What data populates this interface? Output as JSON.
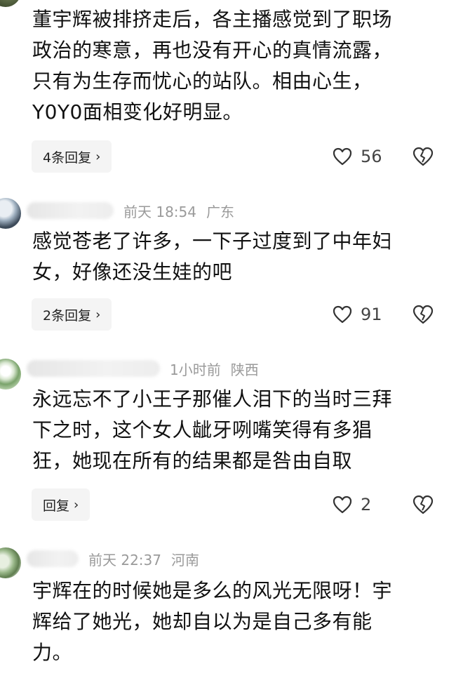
{
  "comments": [
    {
      "name": "",
      "time": "",
      "location": "",
      "text": "董宇辉被排挤走后，各主播感觉到了职场\n政治的寒意，再也没有开心的真情流露，\n只有为生存而忧心的站队。相由心生，\nY0Y0面相变化好明显。",
      "reply_label": "4条回复",
      "like_count": "56"
    },
    {
      "name": "",
      "time": "前天 18:54",
      "location": "广东",
      "text": "感觉苍老了许多，一下子过度到了中年妇\n女，好像还没生娃的吧",
      "reply_label": "2条回复",
      "like_count": "91"
    },
    {
      "name": "",
      "time": "1小时前",
      "location": "陕西",
      "text": "永远忘不了小王子那催人泪下的当时三拜\n下之时，这个女人龇牙咧嘴笑得有多猖\n狂，她现在所有的结果都是咎由自取",
      "reply_label": "回复",
      "like_count": "2"
    },
    {
      "name": "",
      "time": "前天 22:37",
      "location": "河南",
      "text": "宇辉在的时候她是多么的风光无限呀！宇\n辉给了她光，她却自以为是自己多有能\n力。"
    }
  ],
  "icons": {
    "like": "heart-outline-icon",
    "dislike": "broken-heart-icon",
    "chevron": "chevron-right-icon"
  }
}
